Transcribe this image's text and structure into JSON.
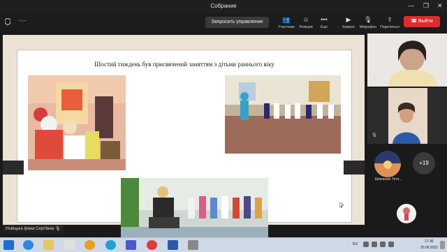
{
  "window": {
    "title": "Собрание",
    "controls": [
      "—",
      "❐",
      "✕"
    ]
  },
  "toolbar": {
    "left_indicator": "--:--",
    "control_button": "Запросить управление",
    "tools": [
      {
        "label": "Участники",
        "icon": "participants-icon",
        "glyph": "👥"
      },
      {
        "label": "Реакции",
        "icon": "reactions-icon",
        "glyph": "☺"
      },
      {
        "label": "Еще",
        "icon": "more-icon",
        "glyph": "•••"
      },
      {
        "label": "Камера",
        "icon": "camera-off-icon",
        "glyph": "▶"
      },
      {
        "label": "Микрофон",
        "icon": "microphone-off-icon",
        "glyph": "🎙"
      },
      {
        "label": "Поделиться",
        "icon": "share-icon",
        "glyph": "⇧"
      }
    ],
    "leave_button": "Выйти"
  },
  "slide": {
    "title": "Шостий тиждень був присвячений заняттям з дітьми раннього віку"
  },
  "gallery": {
    "participant_name": "Шевченко Тетя...",
    "more_count": "+19"
  },
  "speaker": {
    "name": "Новіцька Ірина Сергіївна"
  },
  "tray": {
    "lang": "RU",
    "time": "17:36",
    "date": "20.06.2022"
  },
  "colors": {
    "leave": "#e02b2b",
    "toolbar": "#1c1c1c",
    "slide_bg": "#ece3d6"
  }
}
